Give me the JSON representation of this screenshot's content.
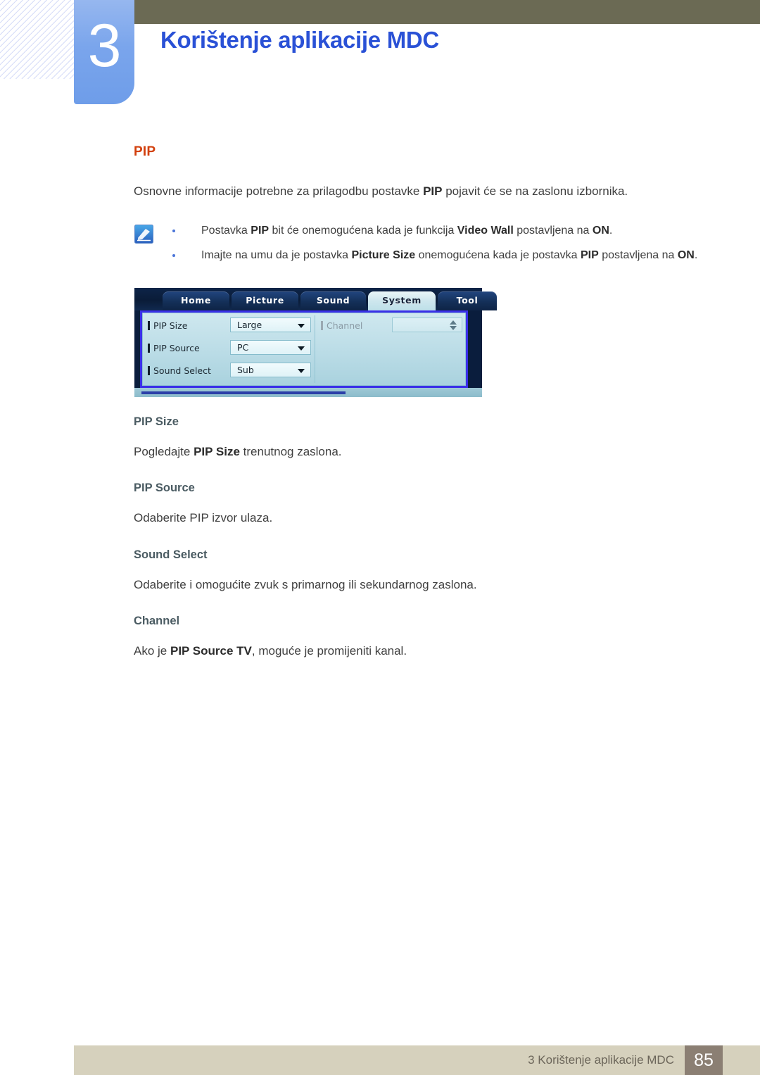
{
  "header": {
    "chapter_number": "3",
    "chapter_title": "Korištenje aplikacije MDC"
  },
  "content": {
    "section_title": "PIP",
    "intro": {
      "part1": "Osnovne informacije potrebne za prilagodbu postavke ",
      "bold1": "PIP",
      "part2": " pojavit će se na zaslonu izbornika."
    },
    "notes": [
      {
        "p1": "Postavka ",
        "b1": "PIP",
        "p2": " bit će onemogućena kada je funkcija ",
        "b2": "Video Wall",
        "p3": " postavljena na ",
        "b3": "ON",
        "p4": "."
      },
      {
        "p1": "Imajte na umu da je postavka ",
        "b1": "Picture Size",
        "p2": " onemogućena kada je postavka ",
        "b2": "PIP",
        "p3": " postavljena na ",
        "b3": "ON",
        "p4": "."
      }
    ],
    "sections": [
      {
        "heading": "PIP Size",
        "p1": "Pogledajte ",
        "b1": "PIP Size",
        "p2": " trenutnog zaslona."
      },
      {
        "heading": "PIP Source",
        "p1": "Odaberite PIP izvor ulaza.",
        "b1": "",
        "p2": ""
      },
      {
        "heading": "Sound Select",
        "p1": "Odaberite i omogućite zvuk s primarnog ili sekundarnog zaslona.",
        "b1": "",
        "p2": ""
      },
      {
        "heading": "Channel",
        "p1": "Ako je ",
        "b1": "PIP Source TV",
        "p2": ", moguće je promijeniti kanal."
      }
    ]
  },
  "mdc_screenshot": {
    "tabs": [
      {
        "label": "Home",
        "selected": false
      },
      {
        "label": "Picture",
        "selected": false
      },
      {
        "label": "Sound",
        "selected": false
      },
      {
        "label": "System",
        "selected": true
      },
      {
        "label": "Tool",
        "selected": false
      }
    ],
    "left_rows": [
      {
        "label": "PIP Size",
        "value": "Large"
      },
      {
        "label": "PIP Source",
        "value": "PC"
      },
      {
        "label": "Sound Select",
        "value": "Sub"
      }
    ],
    "right_rows": [
      {
        "label": "Channel",
        "value": "",
        "disabled": true
      }
    ]
  },
  "footer": {
    "text": "3 Korištenje aplikacije MDC",
    "page": "85"
  },
  "colors": {
    "accent_orange": "#d2400d",
    "chapter_blue": "#2a51d6",
    "olive": "#6b6a54",
    "footer_beige": "#d6d1bd",
    "footer_page_box": "#8b7f73",
    "subheading": "#4a5b62"
  }
}
